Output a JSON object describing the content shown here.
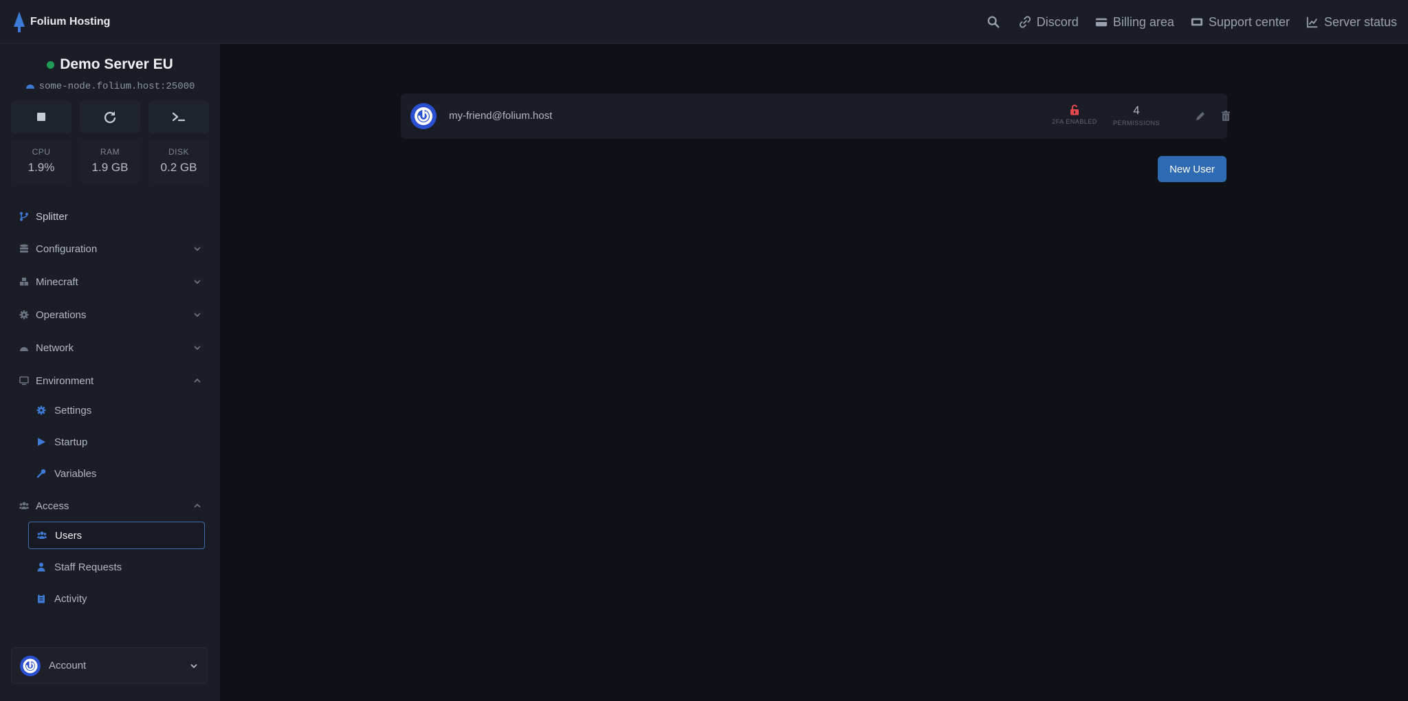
{
  "brand": {
    "name": "Folium Hosting"
  },
  "topnav": {
    "items": [
      {
        "label": "Discord",
        "icon": "link-icon"
      },
      {
        "label": "Billing area",
        "icon": "credit-card-icon"
      },
      {
        "label": "Support center",
        "icon": "ticket-icon"
      },
      {
        "label": "Server status",
        "icon": "chart-line-icon"
      }
    ]
  },
  "server": {
    "name": "Demo Server EU",
    "address": "some-node.folium.host:25000",
    "status_color": "#1f9d55"
  },
  "stats": {
    "cpu_label": "CPU",
    "cpu_value": "1.9%",
    "ram_label": "RAM",
    "ram_value": "1.9 GB",
    "disk_label": "DISK",
    "disk_value": "0.2 GB"
  },
  "sidebar": {
    "splitter": "Splitter",
    "configuration": "Configuration",
    "minecraft": "Minecraft",
    "operations": "Operations",
    "network": "Network",
    "environment": "Environment",
    "env_items": [
      "Settings",
      "Startup",
      "Variables"
    ],
    "access": "Access",
    "access_items": [
      "Users",
      "Staff Requests",
      "Activity"
    ],
    "account": "Account"
  },
  "main": {
    "user_email": "my-friend@folium.host",
    "twofa_label": "2FA ENABLED",
    "permissions_count": "4",
    "permissions_label": "PERMISSIONS",
    "new_user_label": "New User"
  },
  "colors": {
    "accent": "#2f6bb3",
    "danger": "#e5484d",
    "background": "#0f1117",
    "panel": "#1a1d26"
  }
}
